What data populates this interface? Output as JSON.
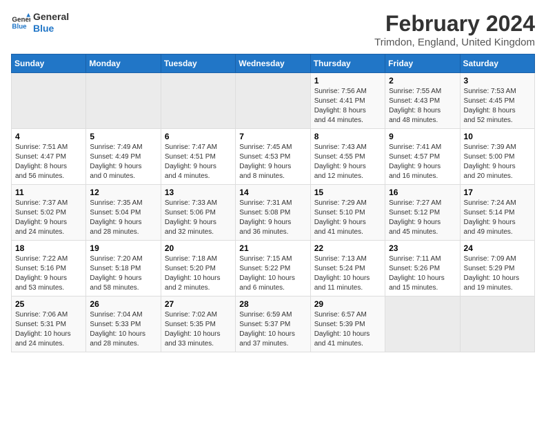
{
  "header": {
    "logo_line1": "General",
    "logo_line2": "Blue",
    "month": "February 2024",
    "location": "Trimdon, England, United Kingdom"
  },
  "days_of_week": [
    "Sunday",
    "Monday",
    "Tuesday",
    "Wednesday",
    "Thursday",
    "Friday",
    "Saturday"
  ],
  "weeks": [
    {
      "days": [
        {
          "num": "",
          "info": "",
          "empty": true
        },
        {
          "num": "",
          "info": "",
          "empty": true
        },
        {
          "num": "",
          "info": "",
          "empty": true
        },
        {
          "num": "",
          "info": "",
          "empty": true
        },
        {
          "num": "1",
          "info": "Sunrise: 7:56 AM\nSunset: 4:41 PM\nDaylight: 8 hours\nand 44 minutes."
        },
        {
          "num": "2",
          "info": "Sunrise: 7:55 AM\nSunset: 4:43 PM\nDaylight: 8 hours\nand 48 minutes."
        },
        {
          "num": "3",
          "info": "Sunrise: 7:53 AM\nSunset: 4:45 PM\nDaylight: 8 hours\nand 52 minutes."
        }
      ]
    },
    {
      "days": [
        {
          "num": "4",
          "info": "Sunrise: 7:51 AM\nSunset: 4:47 PM\nDaylight: 8 hours\nand 56 minutes."
        },
        {
          "num": "5",
          "info": "Sunrise: 7:49 AM\nSunset: 4:49 PM\nDaylight: 9 hours\nand 0 minutes."
        },
        {
          "num": "6",
          "info": "Sunrise: 7:47 AM\nSunset: 4:51 PM\nDaylight: 9 hours\nand 4 minutes."
        },
        {
          "num": "7",
          "info": "Sunrise: 7:45 AM\nSunset: 4:53 PM\nDaylight: 9 hours\nand 8 minutes."
        },
        {
          "num": "8",
          "info": "Sunrise: 7:43 AM\nSunset: 4:55 PM\nDaylight: 9 hours\nand 12 minutes."
        },
        {
          "num": "9",
          "info": "Sunrise: 7:41 AM\nSunset: 4:57 PM\nDaylight: 9 hours\nand 16 minutes."
        },
        {
          "num": "10",
          "info": "Sunrise: 7:39 AM\nSunset: 5:00 PM\nDaylight: 9 hours\nand 20 minutes."
        }
      ]
    },
    {
      "days": [
        {
          "num": "11",
          "info": "Sunrise: 7:37 AM\nSunset: 5:02 PM\nDaylight: 9 hours\nand 24 minutes."
        },
        {
          "num": "12",
          "info": "Sunrise: 7:35 AM\nSunset: 5:04 PM\nDaylight: 9 hours\nand 28 minutes."
        },
        {
          "num": "13",
          "info": "Sunrise: 7:33 AM\nSunset: 5:06 PM\nDaylight: 9 hours\nand 32 minutes."
        },
        {
          "num": "14",
          "info": "Sunrise: 7:31 AM\nSunset: 5:08 PM\nDaylight: 9 hours\nand 36 minutes."
        },
        {
          "num": "15",
          "info": "Sunrise: 7:29 AM\nSunset: 5:10 PM\nDaylight: 9 hours\nand 41 minutes."
        },
        {
          "num": "16",
          "info": "Sunrise: 7:27 AM\nSunset: 5:12 PM\nDaylight: 9 hours\nand 45 minutes."
        },
        {
          "num": "17",
          "info": "Sunrise: 7:24 AM\nSunset: 5:14 PM\nDaylight: 9 hours\nand 49 minutes."
        }
      ]
    },
    {
      "days": [
        {
          "num": "18",
          "info": "Sunrise: 7:22 AM\nSunset: 5:16 PM\nDaylight: 9 hours\nand 53 minutes."
        },
        {
          "num": "19",
          "info": "Sunrise: 7:20 AM\nSunset: 5:18 PM\nDaylight: 9 hours\nand 58 minutes."
        },
        {
          "num": "20",
          "info": "Sunrise: 7:18 AM\nSunset: 5:20 PM\nDaylight: 10 hours\nand 2 minutes."
        },
        {
          "num": "21",
          "info": "Sunrise: 7:15 AM\nSunset: 5:22 PM\nDaylight: 10 hours\nand 6 minutes."
        },
        {
          "num": "22",
          "info": "Sunrise: 7:13 AM\nSunset: 5:24 PM\nDaylight: 10 hours\nand 11 minutes."
        },
        {
          "num": "23",
          "info": "Sunrise: 7:11 AM\nSunset: 5:26 PM\nDaylight: 10 hours\nand 15 minutes."
        },
        {
          "num": "24",
          "info": "Sunrise: 7:09 AM\nSunset: 5:29 PM\nDaylight: 10 hours\nand 19 minutes."
        }
      ]
    },
    {
      "days": [
        {
          "num": "25",
          "info": "Sunrise: 7:06 AM\nSunset: 5:31 PM\nDaylight: 10 hours\nand 24 minutes."
        },
        {
          "num": "26",
          "info": "Sunrise: 7:04 AM\nSunset: 5:33 PM\nDaylight: 10 hours\nand 28 minutes."
        },
        {
          "num": "27",
          "info": "Sunrise: 7:02 AM\nSunset: 5:35 PM\nDaylight: 10 hours\nand 33 minutes."
        },
        {
          "num": "28",
          "info": "Sunrise: 6:59 AM\nSunset: 5:37 PM\nDaylight: 10 hours\nand 37 minutes."
        },
        {
          "num": "29",
          "info": "Sunrise: 6:57 AM\nSunset: 5:39 PM\nDaylight: 10 hours\nand 41 minutes."
        },
        {
          "num": "",
          "info": "",
          "empty": true
        },
        {
          "num": "",
          "info": "",
          "empty": true
        }
      ]
    }
  ]
}
